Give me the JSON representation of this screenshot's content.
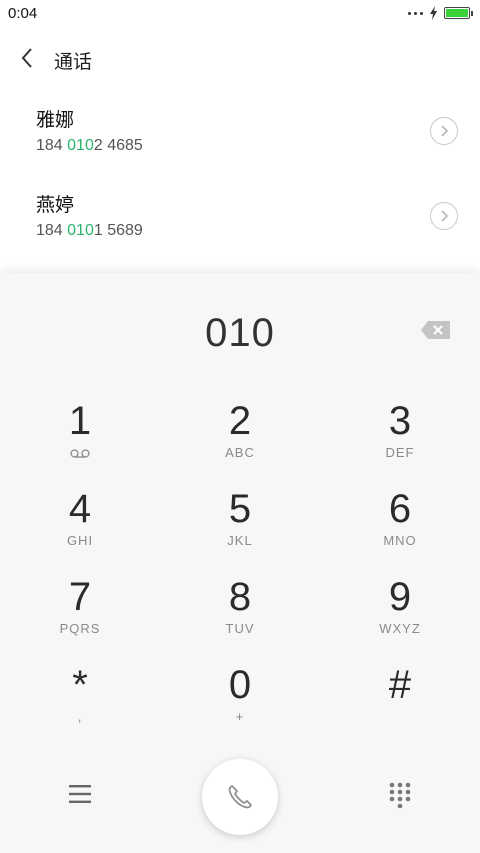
{
  "status_bar": {
    "time": "0:04"
  },
  "header": {
    "title": "通话"
  },
  "contacts": [
    {
      "name": "雅娜",
      "number_prefix": "184 ",
      "number_match": "010",
      "number_suffix": "2 4685"
    },
    {
      "name": "燕婷",
      "number_prefix": "184 ",
      "number_match": "010",
      "number_suffix": "1 5689"
    }
  ],
  "dialpad": {
    "input": "010",
    "keys": [
      {
        "digit": "1",
        "letters": ""
      },
      {
        "digit": "2",
        "letters": "ABC"
      },
      {
        "digit": "3",
        "letters": "DEF"
      },
      {
        "digit": "4",
        "letters": "GHI"
      },
      {
        "digit": "5",
        "letters": "JKL"
      },
      {
        "digit": "6",
        "letters": "MNO"
      },
      {
        "digit": "7",
        "letters": "PQRS"
      },
      {
        "digit": "8",
        "letters": "TUV"
      },
      {
        "digit": "9",
        "letters": "WXYZ"
      },
      {
        "digit": "*",
        "letters": ","
      },
      {
        "digit": "0",
        "letters": "+"
      },
      {
        "digit": "#",
        "letters": ""
      }
    ]
  },
  "icons": {
    "back": "chevron-left-icon",
    "detail": "chevron-right-circle-icon",
    "backspace": "backspace-icon",
    "voicemail": "voicemail-icon",
    "menu": "menu-icon",
    "call": "phone-icon",
    "keypad": "dialpad-icon",
    "battery": "battery-icon",
    "charging": "lightning-icon"
  },
  "colors": {
    "match_highlight": "#2bb36b",
    "battery_fill": "#3ad13a"
  }
}
